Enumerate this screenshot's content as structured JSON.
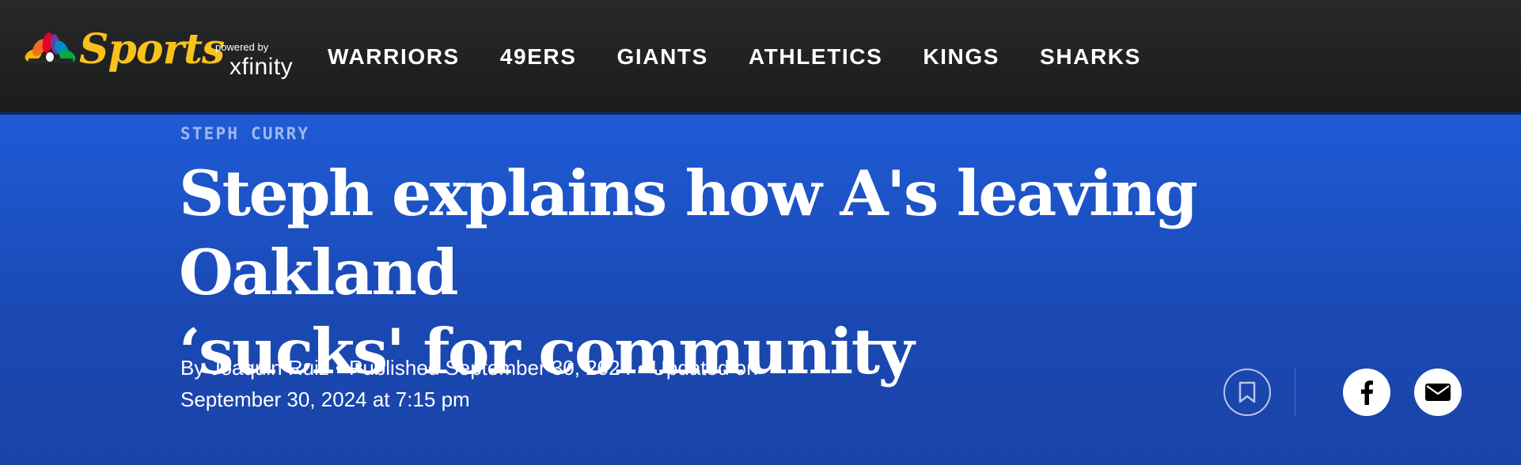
{
  "brand": {
    "sports_label": "Sports",
    "powered_by": "powered by",
    "xfinity": "xfinity",
    "accent": "#f7c21b"
  },
  "nav": {
    "items": [
      {
        "label": "WARRIORS"
      },
      {
        "label": "49ERS"
      },
      {
        "label": "GIANTS"
      },
      {
        "label": "ATHLETICS"
      },
      {
        "label": "KINGS"
      },
      {
        "label": "SHARKS"
      }
    ]
  },
  "article": {
    "category": "STEPH CURRY",
    "headline_line1": "Steph explains how A's leaving Oakland",
    "headline_line2": "‘sucks' for community",
    "author": "By Joaquin Ruiz",
    "published": "Published September 30, 2024",
    "updated_prefix": "Updated on",
    "updated_date": "September 30, 2024 at 7:15 pm",
    "separator": "•"
  },
  "share": {
    "icons": [
      "bookmark-icon",
      "facebook-icon",
      "email-icon"
    ]
  },
  "colors": {
    "topbar": "#222425",
    "hero": "#1f5bd6",
    "category": "#9fb7ee"
  }
}
